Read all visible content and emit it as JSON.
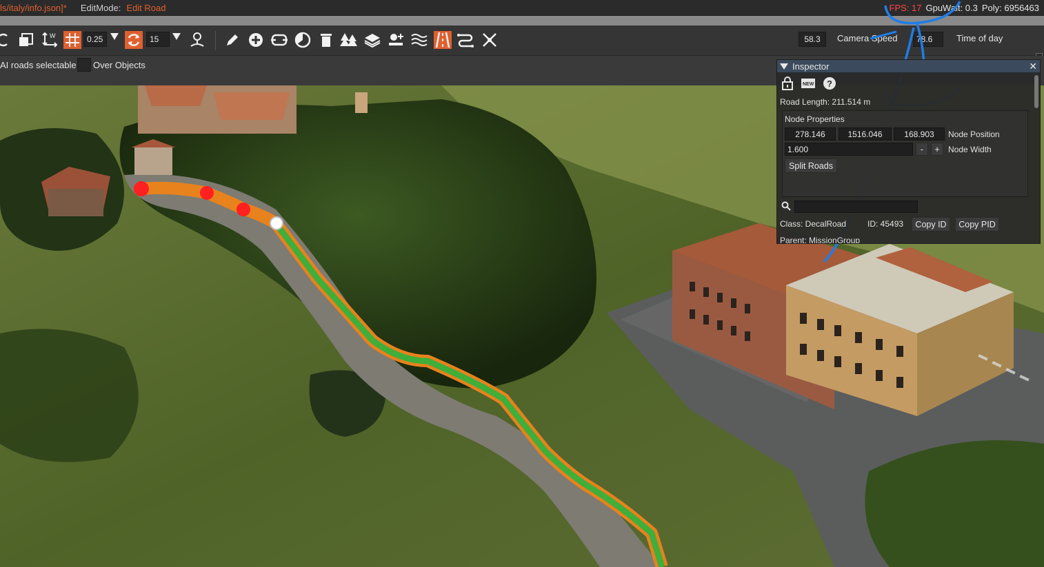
{
  "topbar": {
    "path": "ls/italy/info.json]*",
    "mode_label": "EditMode:",
    "mode_value": "Edit Road",
    "fps": "FPS: 17",
    "gpuwait": "GpuWait: 0.3",
    "poly": "Poly: 6956463"
  },
  "toolbar": {
    "grid_size": "0.25",
    "rotation_snap": "15",
    "camera_speed_value": "58.3",
    "camera_speed_label": "Camera Speed",
    "time_of_day_value": "78.6",
    "time_of_day_label": "Time of day"
  },
  "options": {
    "ai_roads_selectable": "AI roads selectable",
    "over_objects": "Over Objects"
  },
  "inspector": {
    "title": "Inspector",
    "road_length": "Road Length: 211.514 m",
    "node_properties": "Node Properties",
    "pos_x": "278.146",
    "pos_y": "1516.046",
    "pos_z": "168.903",
    "node_position_label": "Node Position",
    "node_width": "1.600",
    "minus": "-",
    "plus": "+",
    "node_width_label": "Node Width",
    "split_roads": "Split Roads",
    "search_placeholder": "",
    "class_text": "Class:  DecalRoad",
    "id_text": "ID:  45493",
    "copy_id": "Copy ID",
    "copy_pid": "Copy PID",
    "parent_text": "Parent:  MissionGroup"
  },
  "colors": {
    "accent_orange": "#e0602f",
    "fps_red": "#ff4444",
    "road_green": "#3fae3a",
    "road_outline": "#e8821c",
    "node_red": "#ff2020",
    "annotation_blue": "#1d7ee8"
  }
}
